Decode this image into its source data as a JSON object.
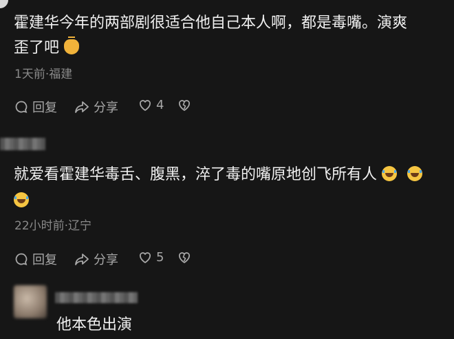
{
  "comments": [
    {
      "text_line1": "霍建华今年的两部剧很适合他自己本人啊，都是毒嘴。演爽",
      "text_line2": "歪了吧",
      "emoji": "clap-hands-icon",
      "meta": "1天前·福建",
      "reply_label": "回复",
      "share_label": "分享",
      "like_count": "4"
    },
    {
      "text_line1": "就爱看霍建华毒舌、腹黑，淬了毒的嘴原地创飞所有人",
      "emoji": "laughing-tears-icon",
      "meta": "22小时前·辽宁",
      "reply_label": "回复",
      "share_label": "分享",
      "like_count": "5"
    },
    {
      "text_line1": "他本色出演"
    }
  ],
  "colors": {
    "background": "#161616",
    "text": "#f0f0f0",
    "meta": "#8a8a8a",
    "action": "#a8a8a8"
  }
}
